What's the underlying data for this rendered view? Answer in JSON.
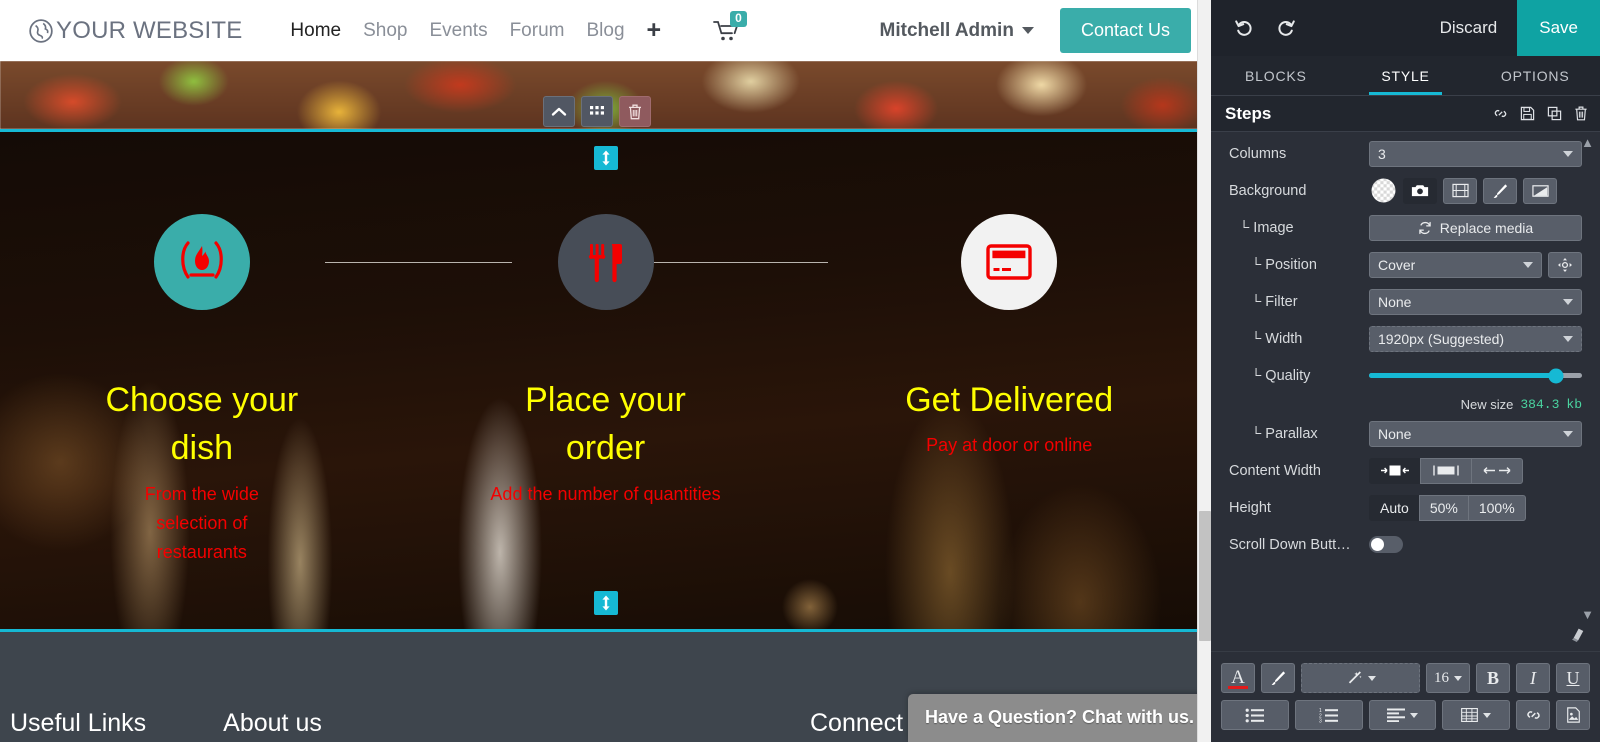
{
  "website": {
    "logo": {
      "text": "YOUR WEBSITE",
      "icon": "globe-icon"
    },
    "nav": [
      {
        "label": "Home",
        "active": true
      },
      {
        "label": "Shop",
        "active": false
      },
      {
        "label": "Events",
        "active": false
      },
      {
        "label": "Forum",
        "active": false
      },
      {
        "label": "Blog",
        "active": false
      }
    ],
    "nav_add_label": "+",
    "cart": {
      "icon": "cart-icon",
      "count": "0"
    },
    "user_menu": {
      "label": "Mitchell Admin"
    },
    "contact_button": "Contact Us",
    "accent_color": "#3aadaa"
  },
  "hero": {
    "steps": [
      {
        "icon": "flame-icon",
        "title": "Choose your dish",
        "desc": "From the wide selection of restaurants",
        "circle_color": "#3aadaa"
      },
      {
        "icon": "fork-knife-icon",
        "title": "Place your order",
        "desc": "Add the number of quantities",
        "circle_color": "#474d57"
      },
      {
        "icon": "credit-card-icon",
        "title": "Get Delivered",
        "desc": "Pay at door or online",
        "circle_color": "#f2f2f2"
      }
    ],
    "title_color": "#ffff00",
    "desc_color": "#f40000",
    "selection_color": "#16b9d4"
  },
  "block_overlay": {
    "move_up": "chevron-up-icon",
    "drag": "grid-drag-icon",
    "delete": "trash-icon"
  },
  "footer": {
    "columns": [
      {
        "heading": "Useful Links"
      },
      {
        "heading": "About us"
      },
      {
        "heading": "Connect with us"
      }
    ]
  },
  "chat_widget": {
    "text": "Have a Question? Chat with us."
  },
  "editor": {
    "topbar": {
      "undo": "undo-icon",
      "redo": "redo-icon",
      "discard_label": "Discard",
      "save_label": "Save",
      "save_color": "#0fa3a3"
    },
    "tabs": [
      {
        "label": "BLOCKS",
        "active": false
      },
      {
        "label": "STYLE",
        "active": true
      },
      {
        "label": "OPTIONS",
        "active": false
      }
    ],
    "panel": {
      "title": "Steps",
      "actions": [
        "link-icon",
        "save-disk-icon",
        "duplicate-icon",
        "trash-icon"
      ]
    },
    "options": {
      "columns": {
        "label": "Columns",
        "value": "3"
      },
      "background": {
        "label": "Background",
        "choices": [
          "transparent-swatch-icon",
          "camera-icon",
          "video-icon",
          "brush-icon",
          "gradient-icon"
        ],
        "selected_index": 1
      },
      "image": {
        "label": "└ Image",
        "button": "Replace media",
        "icon": "refresh-icon"
      },
      "position": {
        "label": "└ Position",
        "value": "Cover",
        "focus_icon": "reposition-icon"
      },
      "filter": {
        "label": "└ Filter",
        "value": "None"
      },
      "width": {
        "label": "└ Width",
        "value": "1920px (Suggested)"
      },
      "quality": {
        "label": "└ Quality",
        "percent": 88
      },
      "new_size": {
        "label": "New size",
        "value": "384.3",
        "unit": "kb",
        "color": "#4ad4a0"
      },
      "parallax": {
        "label": "└ Parallax",
        "value": "None"
      },
      "content_width": {
        "label": "Content Width",
        "choices": [
          "narrow-icon",
          "normal-icon",
          "full-icon"
        ],
        "selected_index": 0
      },
      "height": {
        "label": "Height",
        "choices": [
          "Auto",
          "50%",
          "100%"
        ],
        "selected_index": 0
      },
      "scroll_down": {
        "label": "Scroll Down Butt…",
        "on": false
      }
    },
    "text_toolbar": {
      "eraser": "eraser-icon",
      "row1": [
        {
          "name": "font-color-button",
          "label": "A"
        },
        {
          "name": "background-color-button",
          "label": ""
        },
        {
          "name": "style-picker-button",
          "label": ""
        },
        {
          "name": "font-size-select",
          "label": "16"
        },
        {
          "name": "bold-button",
          "label": "B"
        },
        {
          "name": "italic-button",
          "label": "I"
        },
        {
          "name": "underline-button",
          "label": "U"
        }
      ],
      "row2": [
        {
          "name": "bullet-list-button",
          "label": ""
        },
        {
          "name": "numbered-list-button",
          "label": ""
        },
        {
          "name": "align-button",
          "label": ""
        },
        {
          "name": "table-button",
          "label": ""
        },
        {
          "name": "link-button",
          "label": ""
        },
        {
          "name": "image-button",
          "label": ""
        }
      ]
    }
  }
}
